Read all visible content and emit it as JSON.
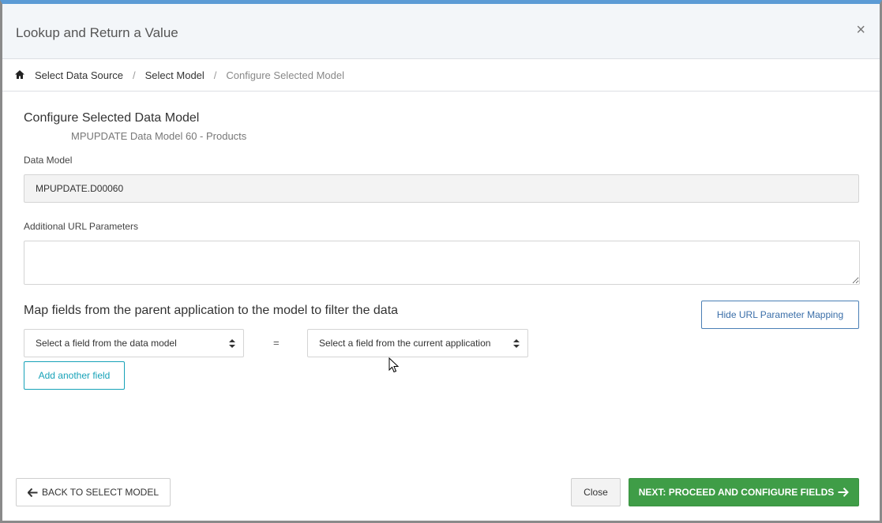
{
  "dialog": {
    "title": "Lookup and Return a Value",
    "close_symbol": "×"
  },
  "breadcrumb": {
    "items": [
      {
        "label": "Select Data Source"
      },
      {
        "label": "Select Model"
      },
      {
        "label": "Configure Selected Model"
      }
    ],
    "separator": "/"
  },
  "section": {
    "title": "Configure Selected Data Model",
    "subtitle": "MPUPDATE Data Model 60 - Products"
  },
  "data_model": {
    "label": "Data Model",
    "value": "MPUPDATE.D00060"
  },
  "url_params": {
    "label": "Additional URL Parameters",
    "value": ""
  },
  "mapping": {
    "title": "Map fields from the parent application to the model to filter the data",
    "hide_button": "Hide URL Parameter Mapping",
    "select_model_field": "Select a field from the data model",
    "equals": "=",
    "select_app_field": "Select a field from the current application",
    "add_button": "Add another field"
  },
  "footer": {
    "back_button": "BACK TO SELECT MODEL",
    "close_button": "Close",
    "next_button": "NEXT: PROCEED AND CONFIGURE FIELDS"
  },
  "colors": {
    "accent_top": "#5b9bd5",
    "primary_green": "#3f9d47",
    "outline_blue": "#3a6ea8",
    "outline_teal": "#17a2b8"
  }
}
